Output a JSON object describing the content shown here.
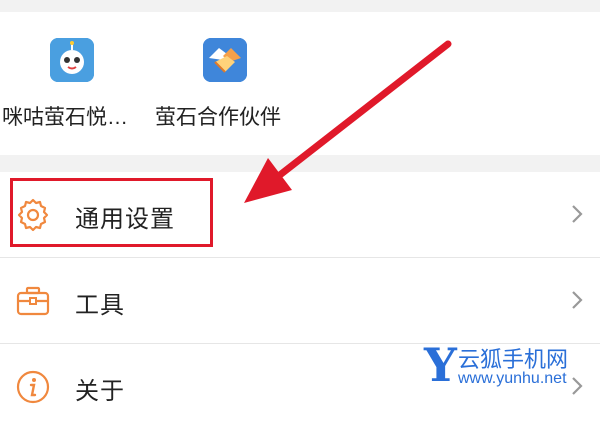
{
  "apps": [
    {
      "label": "咪咕萤石悦…",
      "icon": "robot-mascot-icon"
    },
    {
      "label": "萤石合作伙伴",
      "icon": "handshake-icon"
    }
  ],
  "menu": [
    {
      "label": "通用设置",
      "icon": "gear-icon",
      "highlighted": true
    },
    {
      "label": "工具",
      "icon": "toolbox-icon"
    },
    {
      "label": "关于",
      "icon": "info-icon"
    }
  ],
  "colors": {
    "accent_orange": "#f0883e",
    "highlight_red": "#e0192a",
    "watermark_blue": "#2a6fd8"
  },
  "watermark": {
    "letter": "Y",
    "name": "云狐手机网",
    "url": "www.yunhu.net"
  }
}
